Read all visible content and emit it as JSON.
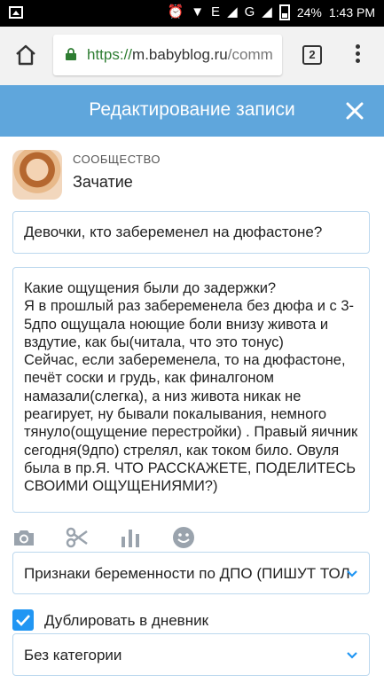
{
  "status_bar": {
    "network": "E",
    "network2": "G",
    "battery": "24%",
    "time": "1:43 PM"
  },
  "browser": {
    "url_scheme": "https://",
    "url_host": "m.babyblog.ru",
    "url_path": "/comm",
    "tab_count": "2"
  },
  "header": {
    "title": "Редактирование записи"
  },
  "community": {
    "label": "СООБЩЕСТВО",
    "name": "Зачатие"
  },
  "post": {
    "title": "Девочки, кто забеременел на дюфастоне?",
    "body": "Какие ощущения были до задержки?\nЯ в прошлый раз забеременела без дюфа и с 3-5дпо ощущала ноющие боли внизу живота и вздутие, как бы(читала, что это тонус)\nСейчас, если забеременела, то на дюфастоне, печёт соски и грудь, как финалгоном намазали(слегка), а низ живота никак не реагирует, ну бывали покалывания, немного тянуло(ощущение перестройки) . Правый яичник сегодня(9дпо) стрелял, как током било. Овуля была в пр.Я. ЧТО РАССКАЖЕТЕ, ПОДЕЛИТЕСЬ СВОИМИ ОЩУЩЕНИЯМИ?)"
  },
  "toolbar": {
    "icons": [
      "camera-icon",
      "scissors-icon",
      "chart-icon",
      "smiley-icon"
    ]
  },
  "tag_select": {
    "value": "Признаки беременности по ДПО (ПИШУТ ТОЛ"
  },
  "duplicate": {
    "label": "Дублировать в дневник",
    "checked": true
  },
  "category_select": {
    "value": "Без категории"
  },
  "colors": {
    "header": "#5fa6dc",
    "accent": "#2196f3",
    "field_border": "#bcd8ee"
  }
}
